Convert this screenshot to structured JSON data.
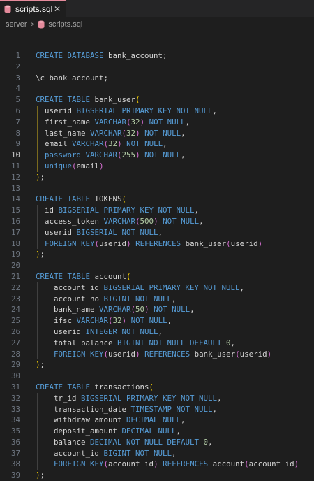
{
  "tab": {
    "label": "scripts.sql",
    "close": "✕"
  },
  "breadcrumb": {
    "folder": "server",
    "file": "scripts.sql"
  },
  "colors": {
    "keyword": "#569cd6",
    "number": "#b5cea8",
    "text": "#d4d4d4",
    "bracket": "#ffd700",
    "background": "#1e1e1e"
  },
  "active_line": 10,
  "lines": [
    {
      "n": 1,
      "tokens": [
        [
          "k",
          "CREATE DATABASE "
        ],
        [
          "t",
          "bank_account;"
        ]
      ]
    },
    {
      "n": 2,
      "tokens": []
    },
    {
      "n": 3,
      "tokens": [
        [
          "t",
          "\\c bank_account;"
        ]
      ]
    },
    {
      "n": 4,
      "tokens": []
    },
    {
      "n": 5,
      "tokens": [
        [
          "k",
          "CREATE TABLE "
        ],
        [
          "t",
          "bank_user"
        ],
        [
          "p",
          "("
        ]
      ]
    },
    {
      "n": 6,
      "tokens": [
        [
          "t",
          "  userid "
        ],
        [
          "k",
          "BIGSERIAL PRIMARY KEY NOT NULL"
        ],
        [
          "t",
          ","
        ]
      ]
    },
    {
      "n": 7,
      "tokens": [
        [
          "t",
          "  first_name "
        ],
        [
          "k",
          "VARCHAR"
        ],
        [
          "p2",
          "("
        ],
        [
          "n",
          "32"
        ],
        [
          "p2",
          ")"
        ],
        [
          "k",
          " NOT NULL"
        ],
        [
          "t",
          ","
        ]
      ]
    },
    {
      "n": 8,
      "tokens": [
        [
          "t",
          "  last_name "
        ],
        [
          "k",
          "VARCHAR"
        ],
        [
          "p2",
          "("
        ],
        [
          "n",
          "32"
        ],
        [
          "p2",
          ")"
        ],
        [
          "k",
          " NOT NULL"
        ],
        [
          "t",
          ","
        ]
      ]
    },
    {
      "n": 9,
      "tokens": [
        [
          "t",
          "  email "
        ],
        [
          "k",
          "VARCHAR"
        ],
        [
          "p2",
          "("
        ],
        [
          "n",
          "32"
        ],
        [
          "p2",
          ")"
        ],
        [
          "k",
          " NOT NULL"
        ],
        [
          "t",
          ","
        ]
      ]
    },
    {
      "n": 10,
      "tokens": [
        [
          "t",
          "  "
        ],
        [
          "k",
          "password VARCHAR"
        ],
        [
          "p2",
          "("
        ],
        [
          "n",
          "255"
        ],
        [
          "p2",
          ")"
        ],
        [
          "k",
          " NOT NULL"
        ],
        [
          "t",
          ","
        ]
      ]
    },
    {
      "n": 11,
      "tokens": [
        [
          "t",
          "  "
        ],
        [
          "k",
          "unique"
        ],
        [
          "p2",
          "("
        ],
        [
          "t",
          "email"
        ],
        [
          "p2",
          ")"
        ]
      ]
    },
    {
      "n": 12,
      "tokens": [
        [
          "p",
          ")"
        ],
        [
          "t",
          ";"
        ]
      ]
    },
    {
      "n": 13,
      "tokens": []
    },
    {
      "n": 14,
      "tokens": [
        [
          "k",
          "CREATE TABLE "
        ],
        [
          "t",
          "TOKENS"
        ],
        [
          "p",
          "("
        ]
      ]
    },
    {
      "n": 15,
      "tokens": [
        [
          "t",
          "  id "
        ],
        [
          "k",
          "BIGSERIAL PRIMARY KEY NOT NULL"
        ],
        [
          "t",
          ","
        ]
      ]
    },
    {
      "n": 16,
      "tokens": [
        [
          "t",
          "  access_token "
        ],
        [
          "k",
          "VARCHAR"
        ],
        [
          "p2",
          "("
        ],
        [
          "n",
          "500"
        ],
        [
          "p2",
          ")"
        ],
        [
          "k",
          " NOT NULL"
        ],
        [
          "t",
          ","
        ]
      ]
    },
    {
      "n": 17,
      "tokens": [
        [
          "t",
          "  userid "
        ],
        [
          "k",
          "BIGSERIAL NOT NULL"
        ],
        [
          "t",
          ","
        ]
      ]
    },
    {
      "n": 18,
      "tokens": [
        [
          "t",
          "  "
        ],
        [
          "k",
          "FOREIGN KEY"
        ],
        [
          "p2",
          "("
        ],
        [
          "t",
          "userid"
        ],
        [
          "p2",
          ")"
        ],
        [
          "k",
          " REFERENCES "
        ],
        [
          "t",
          "bank_user"
        ],
        [
          "p2",
          "("
        ],
        [
          "t",
          "userid"
        ],
        [
          "p2",
          ")"
        ]
      ]
    },
    {
      "n": 19,
      "tokens": [
        [
          "p",
          ")"
        ],
        [
          "t",
          ";"
        ]
      ]
    },
    {
      "n": 20,
      "tokens": []
    },
    {
      "n": 21,
      "tokens": [
        [
          "k",
          "CREATE TABLE "
        ],
        [
          "t",
          "account"
        ],
        [
          "p",
          "("
        ]
      ]
    },
    {
      "n": 22,
      "tokens": [
        [
          "t",
          "    account_id "
        ],
        [
          "k",
          "BIGSERIAL PRIMARY KEY NOT NULL"
        ],
        [
          "t",
          ","
        ]
      ]
    },
    {
      "n": 23,
      "tokens": [
        [
          "t",
          "    account_no "
        ],
        [
          "k",
          "BIGINT NOT NULL"
        ],
        [
          "t",
          ","
        ]
      ]
    },
    {
      "n": 24,
      "tokens": [
        [
          "t",
          "    bank_name "
        ],
        [
          "k",
          "VARCHAR"
        ],
        [
          "p2",
          "("
        ],
        [
          "n",
          "50"
        ],
        [
          "p2",
          ")"
        ],
        [
          "k",
          " NOT NULL"
        ],
        [
          "t",
          ","
        ]
      ]
    },
    {
      "n": 25,
      "tokens": [
        [
          "t",
          "    ifsc "
        ],
        [
          "k",
          "VARCHAR"
        ],
        [
          "p2",
          "("
        ],
        [
          "n",
          "32"
        ],
        [
          "p2",
          ")"
        ],
        [
          "k",
          " NOT NULL"
        ],
        [
          "t",
          ","
        ]
      ]
    },
    {
      "n": 26,
      "tokens": [
        [
          "t",
          "    userid "
        ],
        [
          "k",
          "INTEGER NOT NULL"
        ],
        [
          "t",
          ","
        ]
      ]
    },
    {
      "n": 27,
      "tokens": [
        [
          "t",
          "    total_balance "
        ],
        [
          "k",
          "BIGINT NOT NULL DEFAULT "
        ],
        [
          "n",
          "0"
        ],
        [
          "t",
          ","
        ]
      ]
    },
    {
      "n": 28,
      "tokens": [
        [
          "t",
          "    "
        ],
        [
          "k",
          "FOREIGN KEY"
        ],
        [
          "p2",
          "("
        ],
        [
          "t",
          "userid"
        ],
        [
          "p2",
          ")"
        ],
        [
          "k",
          " REFERENCES "
        ],
        [
          "t",
          "bank_user"
        ],
        [
          "p2",
          "("
        ],
        [
          "t",
          "userid"
        ],
        [
          "p2",
          ")"
        ]
      ]
    },
    {
      "n": 29,
      "tokens": [
        [
          "p",
          ")"
        ],
        [
          "t",
          ";"
        ]
      ]
    },
    {
      "n": 30,
      "tokens": []
    },
    {
      "n": 31,
      "tokens": [
        [
          "k",
          "CREATE TABLE "
        ],
        [
          "t",
          "transactions"
        ],
        [
          "p",
          "("
        ]
      ]
    },
    {
      "n": 32,
      "tokens": [
        [
          "t",
          "    tr_id "
        ],
        [
          "k",
          "BIGSERIAL PRIMARY KEY NOT NULL"
        ],
        [
          "t",
          ","
        ]
      ]
    },
    {
      "n": 33,
      "tokens": [
        [
          "t",
          "    transaction_date "
        ],
        [
          "k",
          "TIMESTAMP NOT NULL"
        ],
        [
          "t",
          ","
        ]
      ]
    },
    {
      "n": 34,
      "tokens": [
        [
          "t",
          "    withdraw_amount "
        ],
        [
          "k",
          "DECIMAL NULL"
        ],
        [
          "t",
          ","
        ]
      ]
    },
    {
      "n": 35,
      "tokens": [
        [
          "t",
          "    deposit_amount "
        ],
        [
          "k",
          "DECIMAL NULL"
        ],
        [
          "t",
          ","
        ]
      ]
    },
    {
      "n": 36,
      "tokens": [
        [
          "t",
          "    balance "
        ],
        [
          "k",
          "DECIMAL NOT NULL DEFAULT "
        ],
        [
          "n",
          "0"
        ],
        [
          "t",
          ","
        ]
      ]
    },
    {
      "n": 37,
      "tokens": [
        [
          "t",
          "    account_id "
        ],
        [
          "k",
          "BIGINT NOT NULL"
        ],
        [
          "t",
          ","
        ]
      ]
    },
    {
      "n": 38,
      "tokens": [
        [
          "t",
          "    "
        ],
        [
          "k",
          "FOREIGN KEY"
        ],
        [
          "p2",
          "("
        ],
        [
          "t",
          "account_id"
        ],
        [
          "p2",
          ")"
        ],
        [
          "k",
          " REFERENCES "
        ],
        [
          "t",
          "account"
        ],
        [
          "p2",
          "("
        ],
        [
          "t",
          "account_id"
        ],
        [
          "p2",
          ")"
        ]
      ]
    },
    {
      "n": 39,
      "tokens": [
        [
          "p",
          ")"
        ],
        [
          "t",
          ";"
        ]
      ]
    }
  ]
}
